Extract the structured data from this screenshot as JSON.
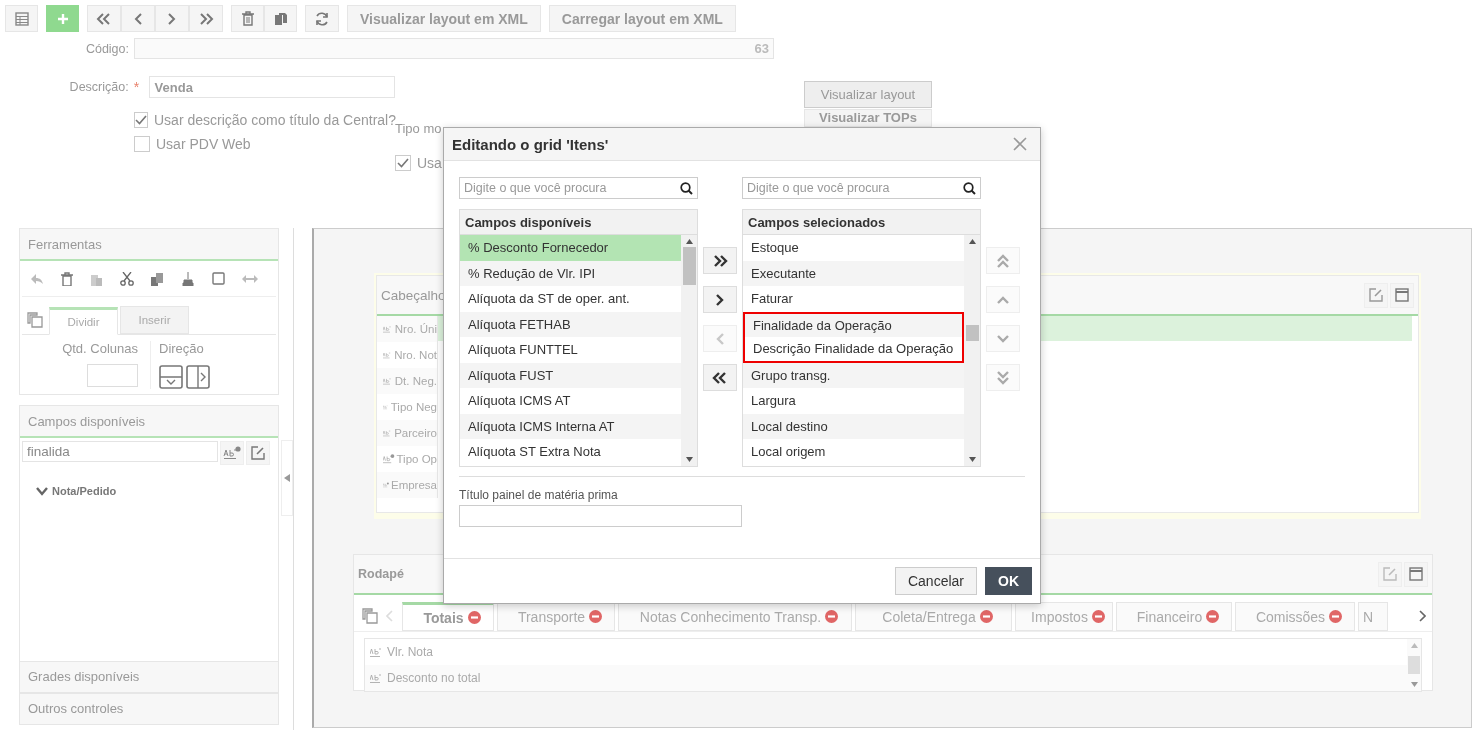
{
  "toolbar": {
    "buttons": [
      "Visualizar layout em XML",
      "Carregar layout em XML"
    ]
  },
  "form": {
    "code": {
      "label": "Código:",
      "value": "63"
    },
    "description": {
      "label": "Descrição:",
      "required_mark": "*",
      "value": "Venda"
    },
    "checks": [
      {
        "label": "Usar descrição como título da Central?",
        "checked": true
      },
      {
        "label": "Usar PDV Web",
        "checked": false
      }
    ],
    "type_label": "Tipo mo",
    "use_check": {
      "label": "Usa",
      "checked": true
    },
    "buttons": [
      "Visualizar layout",
      "Visualizar TOPs"
    ]
  },
  "sidebar": {
    "tools_title": "Ferramentas",
    "tabs": [
      {
        "label": "Dividir",
        "selected": true
      },
      {
        "label": "Inserir",
        "selected": false
      }
    ],
    "columns_label": "Qtd. Colunas",
    "direction_label": "Direção",
    "fields_title": "Campos disponíveis",
    "filter_value": "finalida",
    "tree": [
      {
        "label": "Nota/Pedido",
        "expanded": true
      }
    ],
    "sections": [
      "Grades disponíveis",
      "Outros controles"
    ]
  },
  "header_panel": {
    "title": "Cabeçalho",
    "items": [
      {
        "label": "Nro. Úni",
        "kind": "text"
      },
      {
        "label": "Nro. Not",
        "kind": "text"
      },
      {
        "label": "Dt. Neg.",
        "kind": "text"
      },
      {
        "label": "Tipo Neg",
        "kind": "text"
      },
      {
        "label": "Parceiro",
        "kind": "text"
      },
      {
        "label": "Tipo Op",
        "kind": "linked"
      },
      {
        "label": "Empresa",
        "kind": "linked"
      }
    ]
  },
  "footer_panel": {
    "title": "Rodapé",
    "tabs": [
      {
        "label": "Totais",
        "selected": true
      },
      {
        "label": "Transporte",
        "selected": false
      },
      {
        "label": "Notas Conhecimento Transp.",
        "selected": false
      },
      {
        "label": "Coleta/Entrega",
        "selected": false
      },
      {
        "label": "Impostos",
        "selected": false
      },
      {
        "label": "Financeiro",
        "selected": false
      },
      {
        "label": "Comissões",
        "selected": false
      },
      {
        "label": "N",
        "selected": false
      }
    ],
    "items": [
      {
        "label": "Vlr. Nota"
      },
      {
        "label": "Desconto no total"
      }
    ]
  },
  "dialog": {
    "title": "Editando o grid 'Itens'",
    "left": {
      "placeholder": "Digite o que você procura",
      "heading": "Campos disponíveis",
      "items": [
        {
          "label": "% Desconto Fornecedor",
          "selected": true
        },
        {
          "label": "% Redução de Vlr. IPI",
          "selected": false
        },
        {
          "label": "Alíquota da ST de oper. ant.",
          "selected": false
        },
        {
          "label": "Alíquota FETHAB",
          "selected": false
        },
        {
          "label": "Alíquota FUNTTEL",
          "selected": false
        },
        {
          "label": "Alíquota FUST",
          "selected": false
        },
        {
          "label": "Alíquota ICMS AT",
          "selected": false
        },
        {
          "label": "Alíquota ICMS Interna AT",
          "selected": false
        },
        {
          "label": "Alíquota ST Extra Nota",
          "selected": false
        }
      ]
    },
    "right": {
      "placeholder": "Digite o que você procura",
      "heading": "Campos selecionados",
      "items": [
        {
          "label": "Estoque",
          "selected": false,
          "highlighted": false
        },
        {
          "label": "Executante",
          "selected": false,
          "highlighted": false
        },
        {
          "label": "Faturar",
          "selected": false,
          "highlighted": false
        },
        {
          "label": "Finalidade da Operação",
          "selected": false,
          "highlighted": true
        },
        {
          "label": "Descrição Finalidade da Operação",
          "selected": false,
          "highlighted": true
        },
        {
          "label": "Grupo transg.",
          "selected": false,
          "highlighted": false
        },
        {
          "label": "Largura",
          "selected": false,
          "highlighted": false
        },
        {
          "label": "Local destino",
          "selected": false,
          "highlighted": false
        },
        {
          "label": "Local origem",
          "selected": false,
          "highlighted": false
        }
      ]
    },
    "transfer_buttons": [
      {
        "kind": "all_right",
        "disabled": false
      },
      {
        "kind": "right",
        "disabled": false
      },
      {
        "kind": "left",
        "disabled": true
      },
      {
        "kind": "all_left",
        "disabled": false
      }
    ],
    "order_buttons": [
      {
        "kind": "top",
        "disabled": true
      },
      {
        "kind": "up",
        "disabled": true
      },
      {
        "kind": "down",
        "disabled": true
      },
      {
        "kind": "bottom",
        "disabled": true
      }
    ],
    "caption_label": "Título painel de matéria prima",
    "buttons": [
      {
        "label": "Cancelar",
        "kind": "secondary"
      },
      {
        "label": "OK",
        "kind": "primary"
      }
    ]
  }
}
